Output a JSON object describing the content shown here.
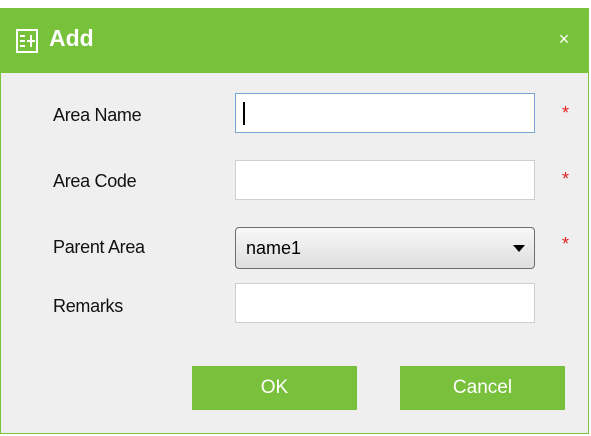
{
  "dialog": {
    "title": "Add",
    "close_label": "×",
    "icon": "add-form-icon"
  },
  "fields": [
    {
      "label": "Area Name",
      "value": "",
      "required_mark": "*"
    },
    {
      "label": "Area Code",
      "value": "",
      "required_mark": "*"
    },
    {
      "label": "Parent Area",
      "value": "name1",
      "required_mark": "*"
    },
    {
      "label": "Remarks",
      "value": ""
    }
  ],
  "buttons": {
    "ok_label": "OK",
    "cancel_label": "Cancel"
  },
  "colors": {
    "accent": "#78c13b",
    "required": "#e02020",
    "background": "#efefef"
  }
}
